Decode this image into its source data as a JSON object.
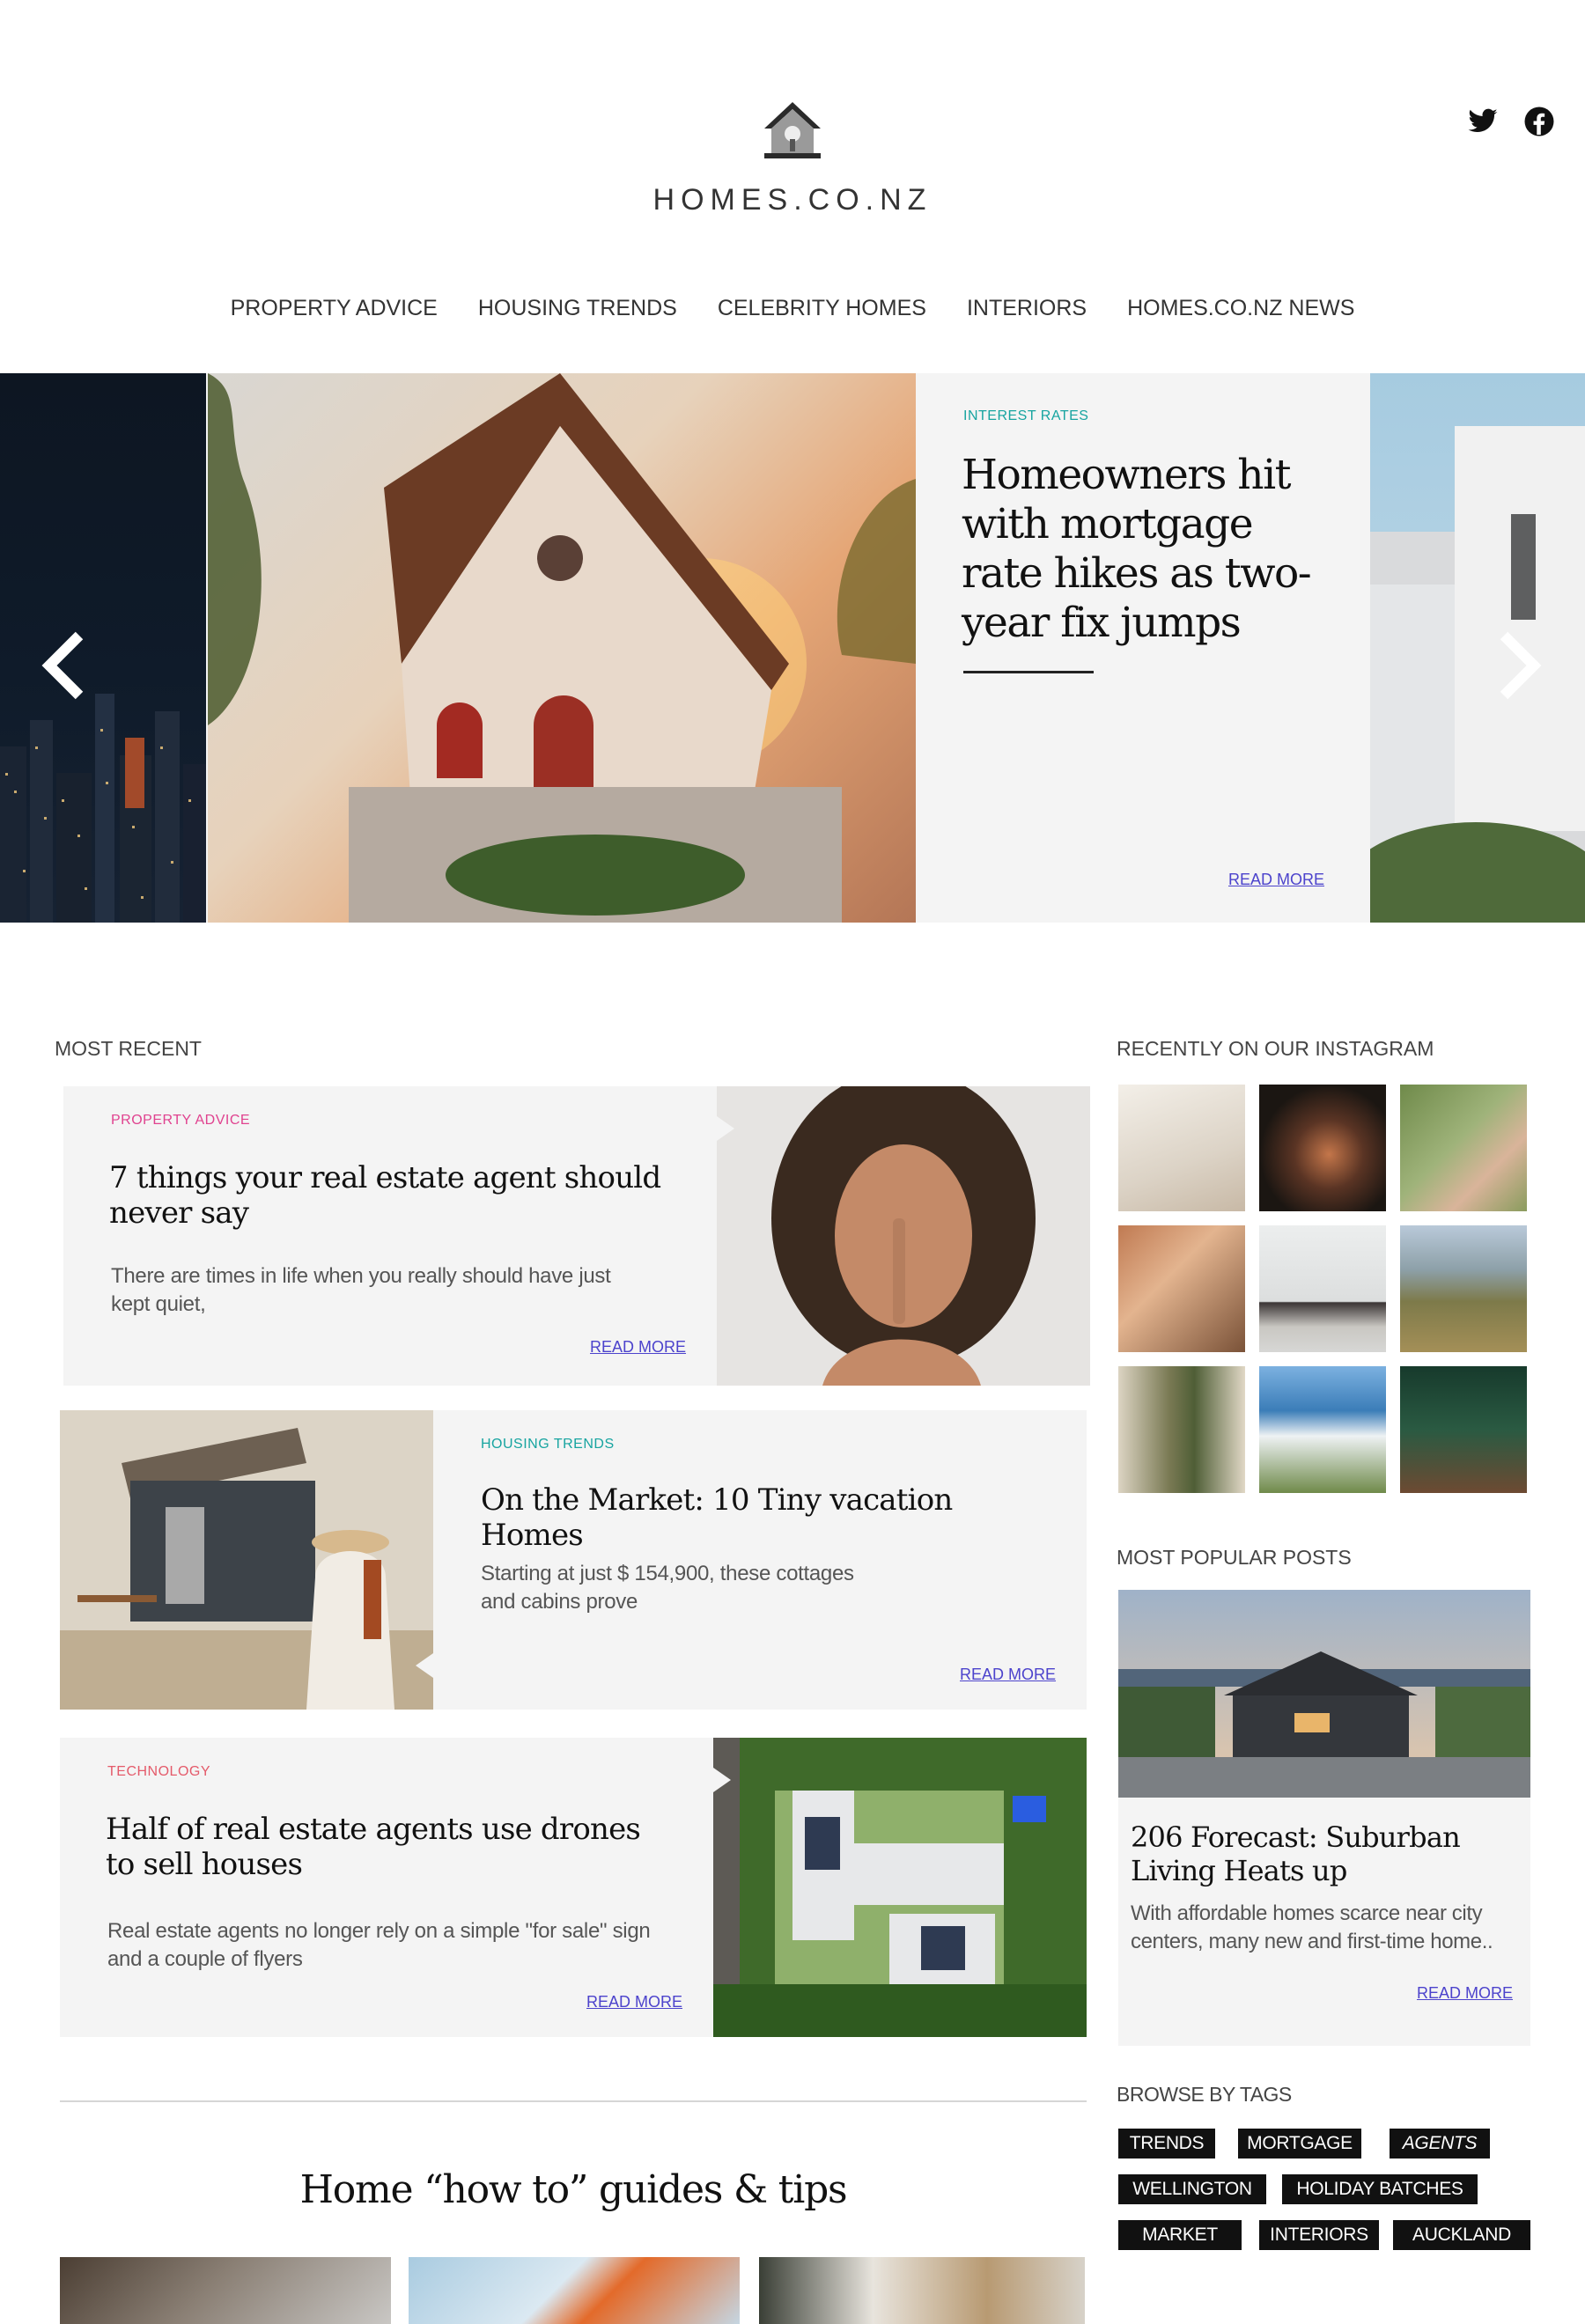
{
  "site": {
    "logo_text": "HOMES.CO.NZ"
  },
  "social": {
    "icons": [
      "twitter-icon",
      "facebook-icon"
    ]
  },
  "nav": {
    "items": [
      "PROPERTY ADVICE",
      "HOUSING TRENDS",
      "CELEBRITY HOMES",
      "INTERIORS",
      "HOMES.CO.NZ NEWS"
    ]
  },
  "hero": {
    "kicker": "INTEREST RATES",
    "title": "Homeowners hit with mortgage rate hikes as two-year fix jumps",
    "read_more": "READ MORE"
  },
  "most_recent": {
    "label": "MOST RECENT",
    "articles": [
      {
        "kicker": "PROPERTY ADVICE",
        "title": "7 things your real estate agent should never say",
        "excerpt": "There are times in life when you really should have just kept quiet,",
        "read_more": "READ MORE"
      },
      {
        "kicker": "HOUSING TRENDS",
        "title": "On the Market: 10 Tiny vacation Homes",
        "excerpt": "Starting at just $ 154,900, these cottages and cabins prove",
        "read_more": "READ MORE"
      },
      {
        "kicker": "TECHNOLOGY",
        "title": "Half of real estate agents use drones to sell houses",
        "excerpt": "Real estate agents no longer rely on a simple \"for sale\" sign and a couple of flyers",
        "read_more": "READ MORE"
      }
    ]
  },
  "instagram": {
    "label": "RECENTLY ON OUR INSTAGRAM"
  },
  "popular": {
    "label": "MOST POPULAR POSTS",
    "title": "206 Forecast: Suburban Living Heats up",
    "excerpt": "With affordable homes scarce near city centers, many new and first-time home..",
    "read_more": "READ MORE"
  },
  "tags": {
    "label": "BROWSE BY TAGS",
    "items": [
      "TRENDS",
      "MORTGAGE",
      "AGENTS",
      "WELLINGTON",
      "HOLIDAY BATCHES",
      "MARKET",
      "INTERIORS",
      "AUCKLAND"
    ]
  },
  "guides": {
    "title": "Home “how to” guides & tips"
  }
}
